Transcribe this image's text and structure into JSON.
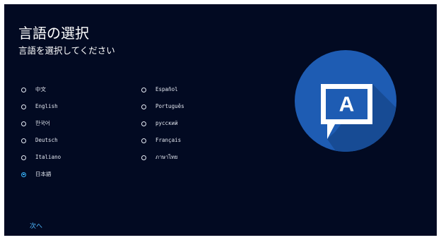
{
  "title": "言語の選択",
  "subtitle": "言語を選択してください",
  "languages": [
    {
      "label": "中文",
      "selected": false
    },
    {
      "label": "English",
      "selected": false
    },
    {
      "label": "한국어",
      "selected": false
    },
    {
      "label": "Deutsch",
      "selected": false
    },
    {
      "label": "Italiano",
      "selected": false
    },
    {
      "label": "日本語",
      "selected": true
    },
    {
      "label": "Español",
      "selected": false
    },
    {
      "label": "Português",
      "selected": false
    },
    {
      "label": "русский",
      "selected": false
    },
    {
      "label": "Français",
      "selected": false
    },
    {
      "label": "ภาษาไทย",
      "selected": false
    }
  ],
  "next_label": "次へ",
  "illustration": {
    "icon": "language-speech-bubble-icon",
    "letter": "A",
    "circle_color": "#1e5cb3",
    "shadow_color": "#174b94"
  },
  "colors": {
    "background": "#020a22",
    "accent": "#39b6ff",
    "text": "#ffffff"
  }
}
